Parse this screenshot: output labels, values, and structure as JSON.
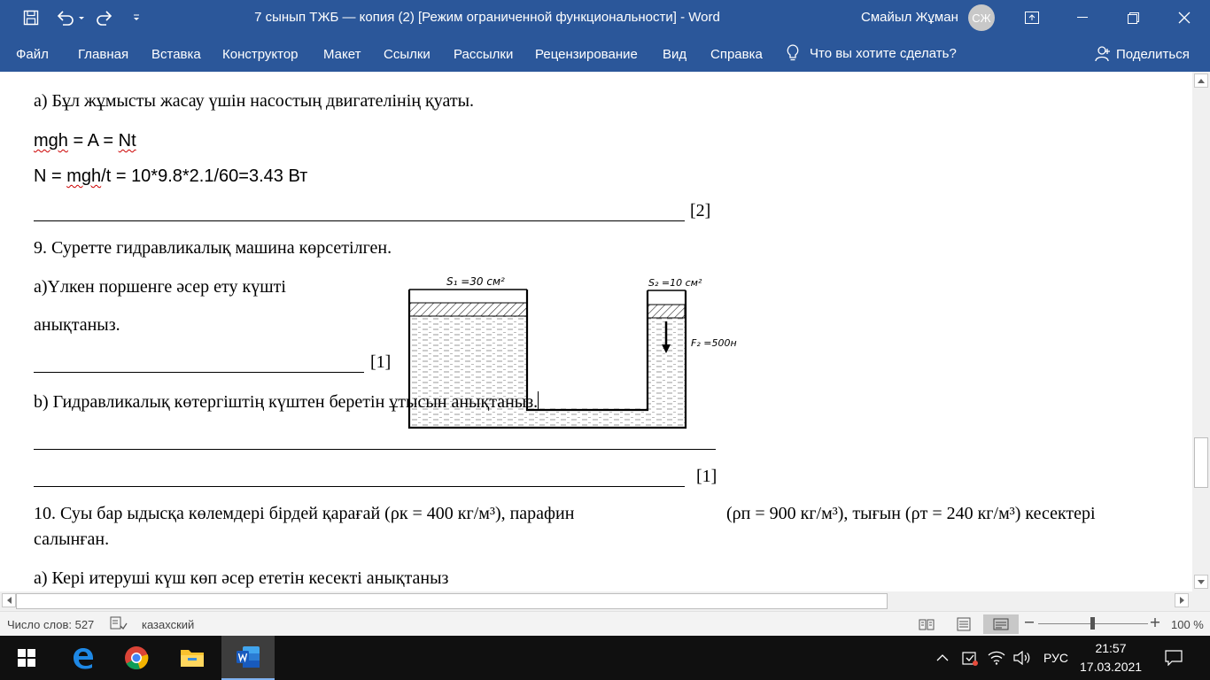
{
  "window": {
    "title": "7 сынып ТЖБ — копия (2) [Режим ограниченной функциональности]  -  Word",
    "user_name": "Смайыл Жұман",
    "user_initials": "СЖ"
  },
  "ribbon": {
    "tabs": [
      "Файл",
      "Главная",
      "Вставка",
      "Конструктор",
      "Макет",
      "Ссылки",
      "Рассылки",
      "Рецензирование",
      "Вид",
      "Справка"
    ],
    "tell_me": "Что вы хотите сделать?",
    "share": "Поделиться"
  },
  "document": {
    "line_a": "а) Бұл жұмысты жасау үшін насостың двигателінің қуаты.",
    "formula1_a": "mgh",
    "formula1_b": " = A = ",
    "formula1_c": "Nt",
    "formula2_a": "N = ",
    "formula2_b": "mgh",
    "formula2_c": "/t = 10*9.8*2.1/60=3.43 Вт",
    "score_2": "[2]",
    "q9": "9. Суретте гидравликалық машина көрсетілген.",
    "q9a_line1": "а)Үлкен поршенге әсер ету күшті",
    "q9a_line2": "анықтаныз.",
    "score_1a": "[1]",
    "q9b": "b) Гидравликалық көтергіштің күштен беретін ұтысын анықтаныз.",
    "score_1b": "[1]",
    "q10_left": "10. Суы бар ыдысқа көлемдері бірдей қарағай (ρк = 400 кг/м³), парафин",
    "q10_right": "(ρп = 900 кг/м³), тығын (ρт = 240 кг/м³) кесектері",
    "q10_line2": "салынған.",
    "q10a": "а) Кері итеруші күш көп әсер ететін кесекті анықтаныз"
  },
  "figure": {
    "s1": "S₁ =30 см²",
    "s2": "S₂ =10 см²",
    "f2": "F₂ =500н"
  },
  "statusbar": {
    "word_count": "Число слов: 527",
    "language": "казахский",
    "zoom": "100 %"
  },
  "taskbar": {
    "lang": "РУС",
    "time": "21:57",
    "date": "17.03.2021"
  },
  "colors": {
    "word_blue": "#2b579a",
    "taskbar": "#101010",
    "spell_underline": "#c00000"
  }
}
